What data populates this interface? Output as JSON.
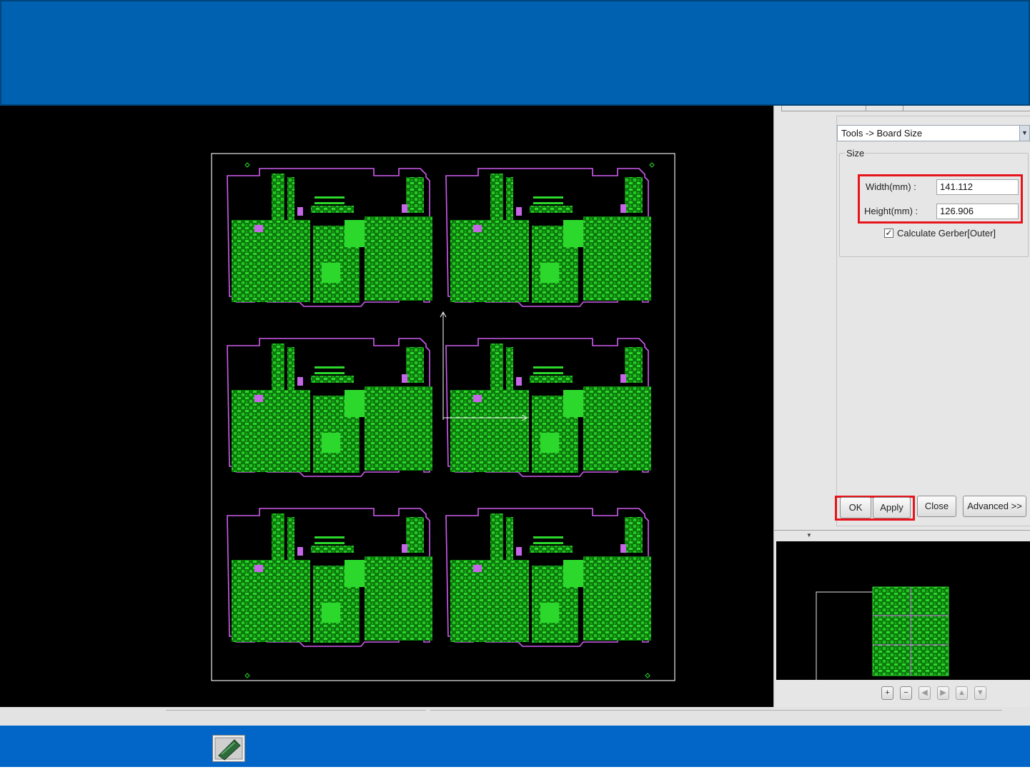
{
  "dialog": {
    "tool_select": "Tools -> Board Size",
    "group_title": "Size",
    "width_label": "Width(mm) :",
    "width_value": "141.112",
    "height_label": "Height(mm) :",
    "height_value": "126.906",
    "checkbox_checked": true,
    "checkbox_mark": "✓",
    "checkbox_label": "Calculate Gerber[Outer]",
    "buttons": {
      "ok": "OK",
      "apply": "Apply",
      "close": "Close",
      "advanced": "Advanced >>"
    }
  },
  "nav_buttons": [
    "+",
    "−",
    "◀",
    "▶",
    "▲",
    "▼"
  ],
  "icons": {
    "dropdown": "chevron-down-icon",
    "collapse": "triangle-down-icon",
    "app": "pcb-tool-icon"
  },
  "colors": {
    "banner_top": "#0061b0",
    "banner_bottom": "#0266c8",
    "pcb_copper": "#1fd11f",
    "board_outline": "#cf5cf0",
    "highlight": "#e8141c",
    "panel_bg": "#e6e6e6"
  }
}
